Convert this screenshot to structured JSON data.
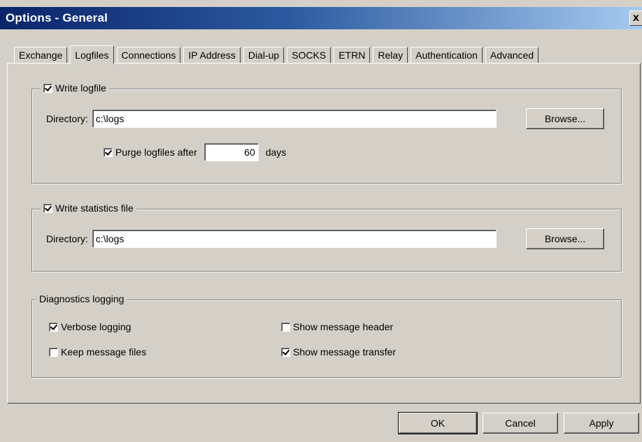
{
  "window": {
    "title": "Options - General",
    "close_label": "x"
  },
  "tabs": [
    {
      "label": "Exchange"
    },
    {
      "label": "Logfiles",
      "active": true
    },
    {
      "label": "Connections"
    },
    {
      "label": "IP Address"
    },
    {
      "label": "Dial-up"
    },
    {
      "label": "SOCKS"
    },
    {
      "label": "ETRN"
    },
    {
      "label": "Relay"
    },
    {
      "label": "Authentication"
    },
    {
      "label": "Advanced"
    }
  ],
  "logfile": {
    "label": "Write logfile",
    "checked": true,
    "directory_label": "Directory:",
    "directory_value": "c:\\logs",
    "browse_label": "Browse...",
    "purge_label": "Purge logfiles after",
    "purge_checked": true,
    "purge_days": "60",
    "days_label": "days"
  },
  "stats": {
    "label": "Write statistics file",
    "checked": true,
    "directory_label": "Directory:",
    "directory_value": "c:\\logs",
    "browse_label": "Browse..."
  },
  "diagnostics": {
    "label": "Diagnostics logging",
    "verbose_label": "Verbose logging",
    "verbose_checked": true,
    "keep_label": "Keep message files",
    "keep_checked": false,
    "header_label": "Show message header",
    "header_checked": false,
    "transfer_label": "Show message transfer",
    "transfer_checked": true
  },
  "buttons": {
    "ok": "OK",
    "cancel": "Cancel",
    "apply": "Apply"
  }
}
